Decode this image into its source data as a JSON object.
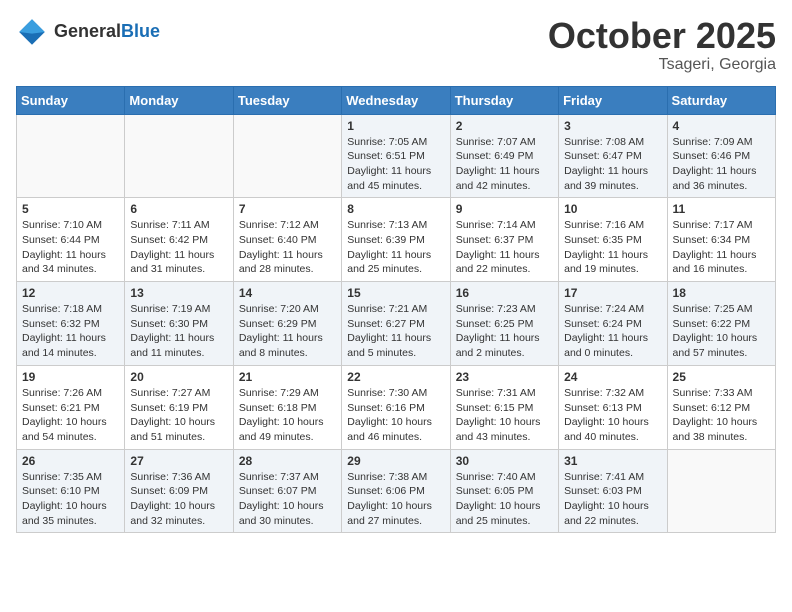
{
  "header": {
    "logo_general": "General",
    "logo_blue": "Blue",
    "month": "October 2025",
    "location": "Tsageri, Georgia"
  },
  "weekdays": [
    "Sunday",
    "Monday",
    "Tuesday",
    "Wednesday",
    "Thursday",
    "Friday",
    "Saturday"
  ],
  "weeks": [
    [
      {
        "day": "",
        "sunrise": "",
        "sunset": "",
        "daylight": ""
      },
      {
        "day": "",
        "sunrise": "",
        "sunset": "",
        "daylight": ""
      },
      {
        "day": "",
        "sunrise": "",
        "sunset": "",
        "daylight": ""
      },
      {
        "day": "1",
        "sunrise": "Sunrise: 7:05 AM",
        "sunset": "Sunset: 6:51 PM",
        "daylight": "Daylight: 11 hours and 45 minutes."
      },
      {
        "day": "2",
        "sunrise": "Sunrise: 7:07 AM",
        "sunset": "Sunset: 6:49 PM",
        "daylight": "Daylight: 11 hours and 42 minutes."
      },
      {
        "day": "3",
        "sunrise": "Sunrise: 7:08 AM",
        "sunset": "Sunset: 6:47 PM",
        "daylight": "Daylight: 11 hours and 39 minutes."
      },
      {
        "day": "4",
        "sunrise": "Sunrise: 7:09 AM",
        "sunset": "Sunset: 6:46 PM",
        "daylight": "Daylight: 11 hours and 36 minutes."
      }
    ],
    [
      {
        "day": "5",
        "sunrise": "Sunrise: 7:10 AM",
        "sunset": "Sunset: 6:44 PM",
        "daylight": "Daylight: 11 hours and 34 minutes."
      },
      {
        "day": "6",
        "sunrise": "Sunrise: 7:11 AM",
        "sunset": "Sunset: 6:42 PM",
        "daylight": "Daylight: 11 hours and 31 minutes."
      },
      {
        "day": "7",
        "sunrise": "Sunrise: 7:12 AM",
        "sunset": "Sunset: 6:40 PM",
        "daylight": "Daylight: 11 hours and 28 minutes."
      },
      {
        "day": "8",
        "sunrise": "Sunrise: 7:13 AM",
        "sunset": "Sunset: 6:39 PM",
        "daylight": "Daylight: 11 hours and 25 minutes."
      },
      {
        "day": "9",
        "sunrise": "Sunrise: 7:14 AM",
        "sunset": "Sunset: 6:37 PM",
        "daylight": "Daylight: 11 hours and 22 minutes."
      },
      {
        "day": "10",
        "sunrise": "Sunrise: 7:16 AM",
        "sunset": "Sunset: 6:35 PM",
        "daylight": "Daylight: 11 hours and 19 minutes."
      },
      {
        "day": "11",
        "sunrise": "Sunrise: 7:17 AM",
        "sunset": "Sunset: 6:34 PM",
        "daylight": "Daylight: 11 hours and 16 minutes."
      }
    ],
    [
      {
        "day": "12",
        "sunrise": "Sunrise: 7:18 AM",
        "sunset": "Sunset: 6:32 PM",
        "daylight": "Daylight: 11 hours and 14 minutes."
      },
      {
        "day": "13",
        "sunrise": "Sunrise: 7:19 AM",
        "sunset": "Sunset: 6:30 PM",
        "daylight": "Daylight: 11 hours and 11 minutes."
      },
      {
        "day": "14",
        "sunrise": "Sunrise: 7:20 AM",
        "sunset": "Sunset: 6:29 PM",
        "daylight": "Daylight: 11 hours and 8 minutes."
      },
      {
        "day": "15",
        "sunrise": "Sunrise: 7:21 AM",
        "sunset": "Sunset: 6:27 PM",
        "daylight": "Daylight: 11 hours and 5 minutes."
      },
      {
        "day": "16",
        "sunrise": "Sunrise: 7:23 AM",
        "sunset": "Sunset: 6:25 PM",
        "daylight": "Daylight: 11 hours and 2 minutes."
      },
      {
        "day": "17",
        "sunrise": "Sunrise: 7:24 AM",
        "sunset": "Sunset: 6:24 PM",
        "daylight": "Daylight: 11 hours and 0 minutes."
      },
      {
        "day": "18",
        "sunrise": "Sunrise: 7:25 AM",
        "sunset": "Sunset: 6:22 PM",
        "daylight": "Daylight: 10 hours and 57 minutes."
      }
    ],
    [
      {
        "day": "19",
        "sunrise": "Sunrise: 7:26 AM",
        "sunset": "Sunset: 6:21 PM",
        "daylight": "Daylight: 10 hours and 54 minutes."
      },
      {
        "day": "20",
        "sunrise": "Sunrise: 7:27 AM",
        "sunset": "Sunset: 6:19 PM",
        "daylight": "Daylight: 10 hours and 51 minutes."
      },
      {
        "day": "21",
        "sunrise": "Sunrise: 7:29 AM",
        "sunset": "Sunset: 6:18 PM",
        "daylight": "Daylight: 10 hours and 49 minutes."
      },
      {
        "day": "22",
        "sunrise": "Sunrise: 7:30 AM",
        "sunset": "Sunset: 6:16 PM",
        "daylight": "Daylight: 10 hours and 46 minutes."
      },
      {
        "day": "23",
        "sunrise": "Sunrise: 7:31 AM",
        "sunset": "Sunset: 6:15 PM",
        "daylight": "Daylight: 10 hours and 43 minutes."
      },
      {
        "day": "24",
        "sunrise": "Sunrise: 7:32 AM",
        "sunset": "Sunset: 6:13 PM",
        "daylight": "Daylight: 10 hours and 40 minutes."
      },
      {
        "day": "25",
        "sunrise": "Sunrise: 7:33 AM",
        "sunset": "Sunset: 6:12 PM",
        "daylight": "Daylight: 10 hours and 38 minutes."
      }
    ],
    [
      {
        "day": "26",
        "sunrise": "Sunrise: 7:35 AM",
        "sunset": "Sunset: 6:10 PM",
        "daylight": "Daylight: 10 hours and 35 minutes."
      },
      {
        "day": "27",
        "sunrise": "Sunrise: 7:36 AM",
        "sunset": "Sunset: 6:09 PM",
        "daylight": "Daylight: 10 hours and 32 minutes."
      },
      {
        "day": "28",
        "sunrise": "Sunrise: 7:37 AM",
        "sunset": "Sunset: 6:07 PM",
        "daylight": "Daylight: 10 hours and 30 minutes."
      },
      {
        "day": "29",
        "sunrise": "Sunrise: 7:38 AM",
        "sunset": "Sunset: 6:06 PM",
        "daylight": "Daylight: 10 hours and 27 minutes."
      },
      {
        "day": "30",
        "sunrise": "Sunrise: 7:40 AM",
        "sunset": "Sunset: 6:05 PM",
        "daylight": "Daylight: 10 hours and 25 minutes."
      },
      {
        "day": "31",
        "sunrise": "Sunrise: 7:41 AM",
        "sunset": "Sunset: 6:03 PM",
        "daylight": "Daylight: 10 hours and 22 minutes."
      },
      {
        "day": "",
        "sunrise": "",
        "sunset": "",
        "daylight": ""
      }
    ]
  ]
}
